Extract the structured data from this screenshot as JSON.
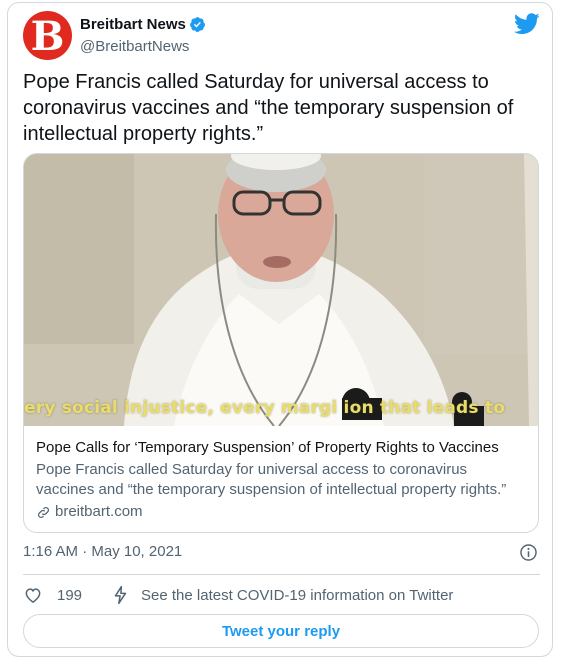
{
  "tweet": {
    "author_name": "Breitbart News",
    "author_handle": "@BreitbartNews",
    "avatar_letter": "B",
    "verified": true,
    "text": "Pope Francis called Saturday for universal access to coronavirus vaccines and “the temporary suspension of intellectual property rights.”",
    "timestamp": "1:16 AM · May 10, 2021",
    "like_count": "199",
    "covid_link": "See the latest COVID-19 information on Twitter",
    "reply_button": "Tweet your reply"
  },
  "link_card": {
    "image_caption": "ery social injustice, every margi      ion that leads to",
    "title": "Pope Calls for ‘Temporary Suspension’ of Property Rights to Vaccines",
    "description": "Pope Francis called Saturday for universal access to coronavirus vaccines and “the temporary suspension of intellectual property rights.”",
    "domain": "breitbart.com"
  },
  "icons": {
    "twitter": "twitter-bird-icon",
    "verified": "verified-badge-icon",
    "info": "info-icon",
    "like": "heart-icon",
    "covid": "lightning-icon",
    "link": "link-icon"
  },
  "colors": {
    "brand_blue": "#1d9bf0",
    "avatar_red": "#e02a1f",
    "text_primary": "#0f1419",
    "text_secondary": "#536471",
    "border": "#cfd9de"
  }
}
